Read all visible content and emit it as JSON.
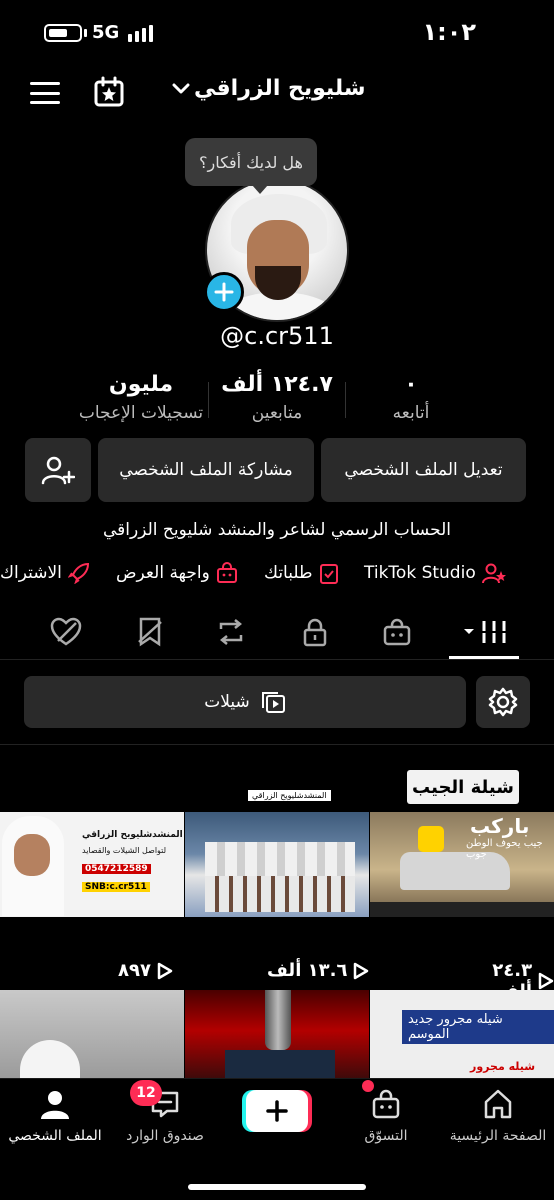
{
  "status_bar": {
    "time": "١:٠٢",
    "network": "5G"
  },
  "header": {
    "account_name": "شليويح الزراقي"
  },
  "profile": {
    "bubble_text": "هل لديك أفكار؟",
    "username": "@c.cr511",
    "bio": "الحساب الرسمي لشاعر والمنشد شليويح الزراقي"
  },
  "stats": {
    "following": {
      "value": "٠",
      "label": "أتابعه"
    },
    "followers": {
      "value": "١٢٤.٧ ألف",
      "label": "متابعين"
    },
    "likes": {
      "value": "مليون",
      "label": "تسجيلات الإعجاب"
    }
  },
  "actions": {
    "edit_profile": "تعديل الملف الشخصي",
    "share_profile": "مشاركة الملف الشخصي"
  },
  "links": {
    "tiktok_studio": "TikTok Studio",
    "orders": "طلباتك",
    "showcase": "واجهة العرض",
    "subscription": "الاشتراك"
  },
  "playlists": {
    "button_label": "شيلات",
    "title": "شيلة الجيب"
  },
  "videos": [
    {
      "views": "٢٤.٣ ألف",
      "thumb_text_1": "باركب",
      "thumb_text_2": "جيب يحوف الوطن جوب"
    },
    {
      "views": "١٣.٦ ألف",
      "thumb_text_1": "المنشدشليويح الزراقي"
    },
    {
      "views": "٨٩٧",
      "thumb_text_1": "المنشدشليويح الزراقي",
      "thumb_text_2": "لتواصل الشيلات والقصايد",
      "thumb_text_3": "0547212589",
      "thumb_text_4": "SNB:c.cr511"
    },
    {
      "thumb_text_1": "شيله مجرور جديد الموسم",
      "thumb_text_2": "شيله مجرور"
    },
    {},
    {}
  ],
  "bottom_nav": {
    "home": "الصفحة الرئيسية",
    "shop": "التسوّق",
    "inbox": "صندوق الوارد",
    "inbox_badge": "12",
    "profile": "الملف الشخصي"
  },
  "colors": {
    "accent_red": "#fe2c55",
    "accent_cyan": "#25f4ee",
    "avatar_add": "#29b6e6",
    "button_bg": "#2a2a2a"
  }
}
